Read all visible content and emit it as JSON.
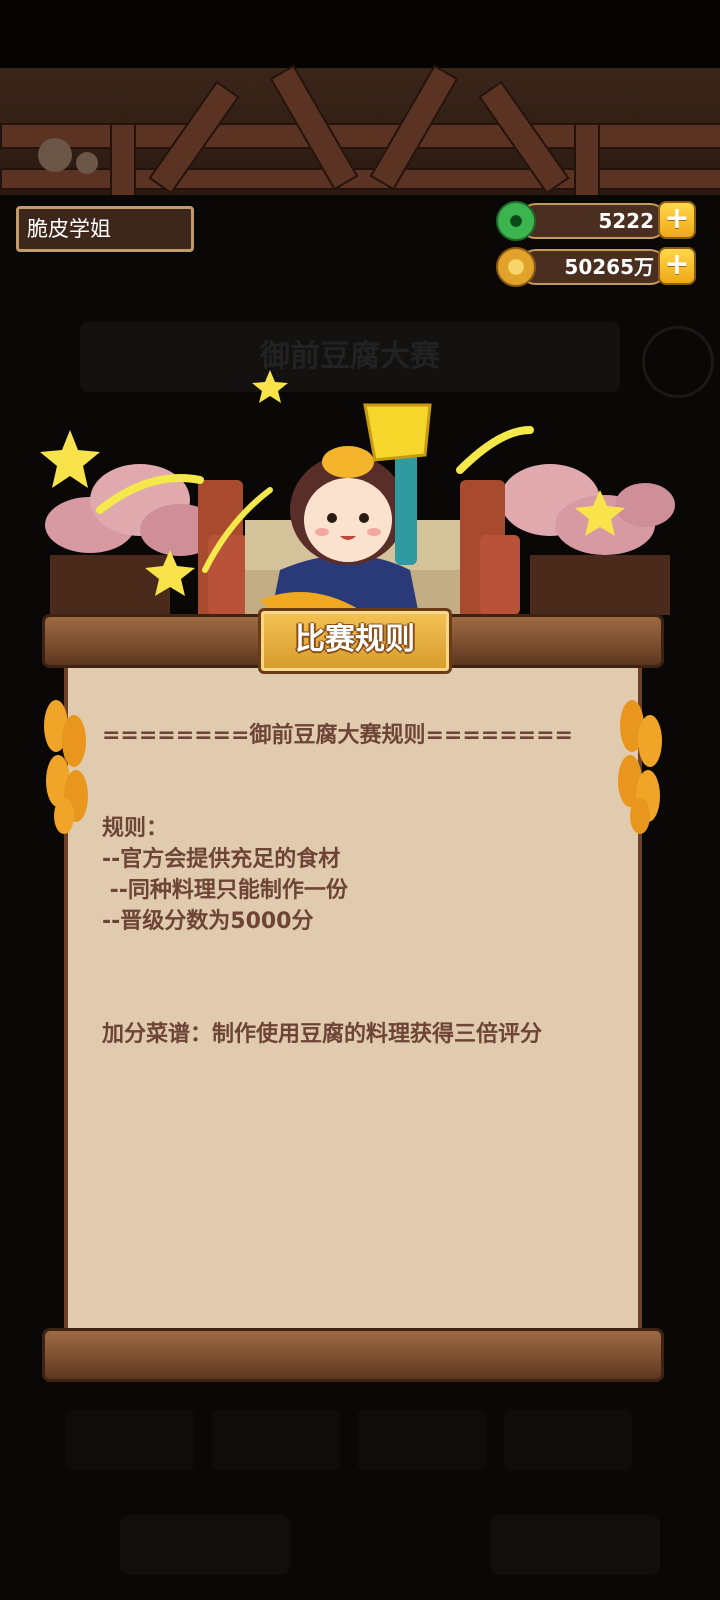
{
  "player": {
    "name": "脆皮学姐"
  },
  "resources": [
    {
      "icon": "jade-coin-icon",
      "value": "5222",
      "color": "#35a94a"
    },
    {
      "icon": "copper-coin-icon",
      "value": "50265万",
      "color": "#f1b82c"
    }
  ],
  "background": {
    "event_title": "御前豆腐大赛"
  },
  "dialog": {
    "title": "比赛规则",
    "heading": "========御前豆腐大赛规则========",
    "rules_label": "规则：",
    "rules": [
      "--官方会提供充足的食材",
      " --同种料理只能制作一份",
      "--晋级分数为5000分"
    ],
    "bonus": "加分菜谱：制作使用豆腐的料理获得三倍评分"
  },
  "colors": {
    "paper": "#e0cbaf",
    "text": "#6d4436",
    "wood": "#7a4d2e",
    "gold": "#f4c254"
  }
}
